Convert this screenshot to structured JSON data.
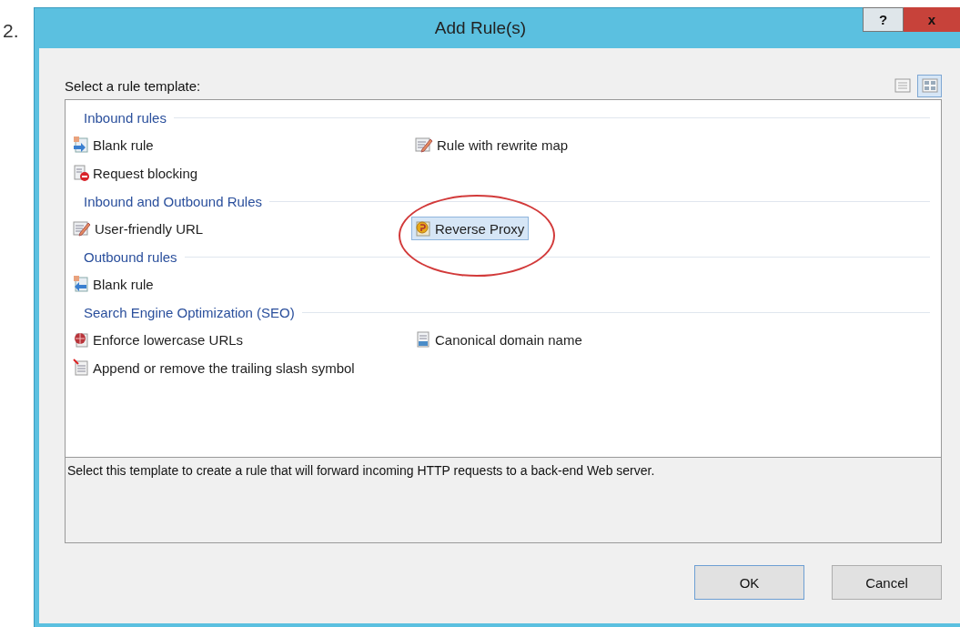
{
  "step_number": "2.",
  "window": {
    "title": "Add Rule(s)",
    "help_button": "?",
    "close_button": "x"
  },
  "prompt": "Select a rule template:",
  "view_buttons": [
    {
      "selected": false
    },
    {
      "selected": true
    }
  ],
  "groups": [
    {
      "heading": "Inbound rules",
      "rows": [
        [
          {
            "label": "Blank rule",
            "selected": false
          },
          {
            "label": "Rule with rewrite map",
            "selected": false
          }
        ],
        [
          {
            "label": "Request blocking",
            "selected": false
          }
        ]
      ]
    },
    {
      "heading": "Inbound and Outbound Rules",
      "rows": [
        [
          {
            "label": "User-friendly URL",
            "selected": false
          },
          {
            "label": "Reverse Proxy",
            "selected": true,
            "circled": true
          }
        ]
      ]
    },
    {
      "heading": "Outbound rules",
      "rows": [
        [
          {
            "label": "Blank rule",
            "selected": false
          }
        ]
      ]
    },
    {
      "heading": "Search Engine Optimization (SEO)",
      "rows": [
        [
          {
            "label": "Enforce lowercase URLs",
            "selected": false
          },
          {
            "label": "Canonical domain name",
            "selected": false
          }
        ],
        [
          {
            "label": "Append or remove the trailing slash symbol",
            "selected": false
          }
        ]
      ]
    }
  ],
  "description": "Select this template to create a rule that will forward incoming HTTP requests to a back-end Web server.",
  "buttons": [
    "OK",
    "Cancel"
  ]
}
